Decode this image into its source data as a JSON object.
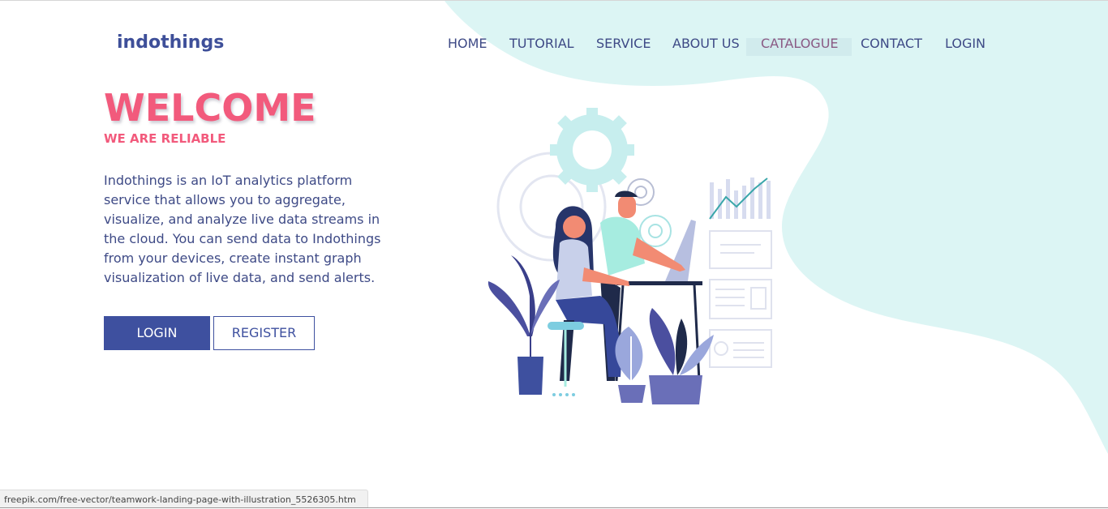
{
  "brand": {
    "name": "indothings"
  },
  "nav": {
    "items": [
      {
        "label": "HOME"
      },
      {
        "label": "TUTORIAL"
      },
      {
        "label": "SERVICE"
      },
      {
        "label": "ABOUT US"
      },
      {
        "label": "CATALOGUE"
      },
      {
        "label": "CONTACT"
      },
      {
        "label": "LOGIN"
      }
    ],
    "active_index": 4
  },
  "hero": {
    "title": "WELCOME",
    "tagline": "WE ARE RELIABLE",
    "description": "Indothings is an IoT analytics platform service that allows you to aggregate, visualize, and analyze live data streams in the cloud. You can send data to Indothings from your devices, create instant graph visualization of live data, and send alerts.",
    "login_label": "LOGIN",
    "register_label": "REGISTER"
  },
  "status_bar": {
    "url": "freepik.com/free-vector/teamwork-landing-page-with-illustration_5526305.htm"
  },
  "colors": {
    "brand": "#3e4f99",
    "accent": "#f25a7c",
    "blob": "#dcf5f4",
    "nav_text": "#3e4a86",
    "nav_active": "#8a5a84"
  },
  "icons": [
    "gear-icon",
    "line-chart-icon",
    "document-icon",
    "plant-icon"
  ]
}
